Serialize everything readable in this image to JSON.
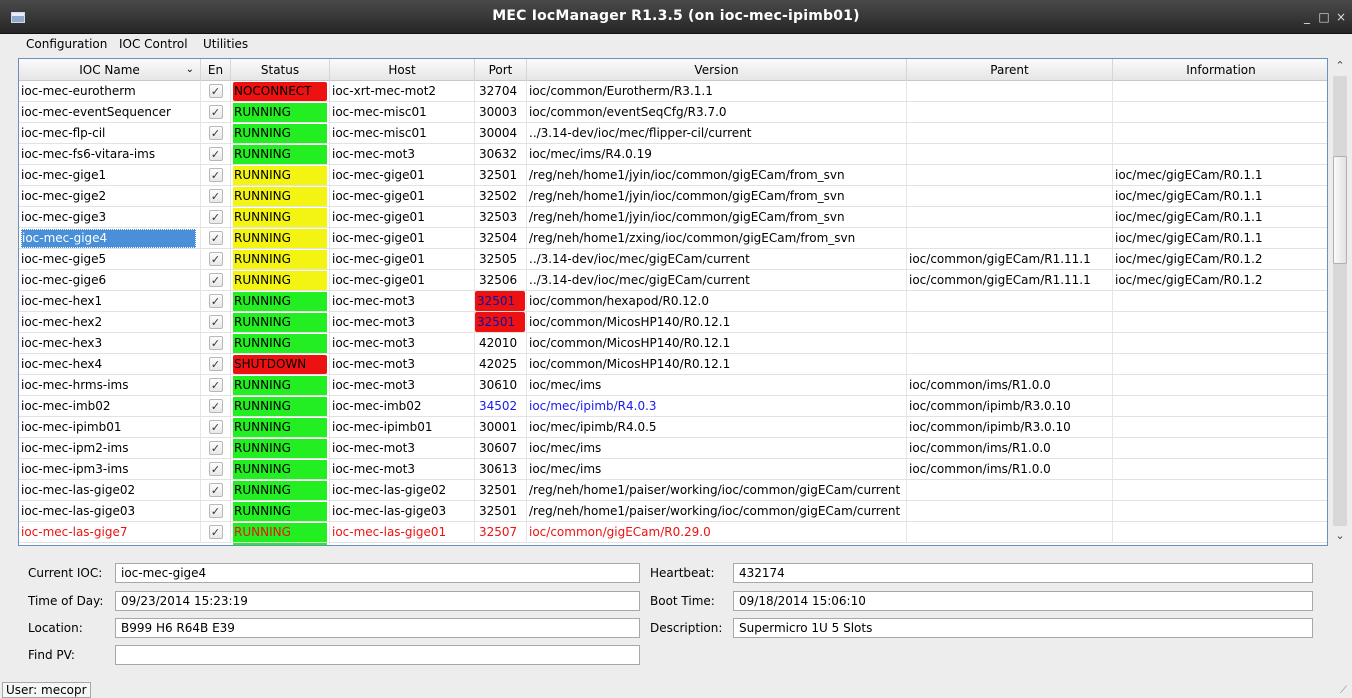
{
  "window": {
    "title": "MEC IocManager R1.3.5 (on ioc-mec-ipimb01)",
    "minimize_glyph": "_",
    "maximize_glyph": "□",
    "close_glyph": "×"
  },
  "menu": [
    "Configuration",
    "IOC Control",
    "Utilities"
  ],
  "table": {
    "headers": {
      "name": "IOC Name",
      "en": "En",
      "status": "Status",
      "host": "Host",
      "port": "Port",
      "version": "Version",
      "parent": "Parent",
      "info": "Information"
    },
    "sort_glyph": "⌄",
    "check_glyph": "✓",
    "rows": [
      {
        "name": "ioc-mec-eurotherm",
        "status": "NOCONNECT",
        "status_color": "red",
        "host": "ioc-xrt-mec-mot2",
        "port": "32704",
        "version": "ioc/common/Eurotherm/R3.1.1",
        "parent": "",
        "info": ""
      },
      {
        "name": "ioc-mec-eventSequencer",
        "status": "RUNNING",
        "status_color": "green",
        "host": "ioc-mec-misc01",
        "port": "30003",
        "version": "ioc/common/eventSeqCfg/R3.7.0",
        "parent": "",
        "info": ""
      },
      {
        "name": "ioc-mec-flp-cil",
        "status": "RUNNING",
        "status_color": "green",
        "host": "ioc-mec-misc01",
        "port": "30004",
        "version": "../3.14-dev/ioc/mec/flipper-cil/current",
        "parent": "",
        "info": ""
      },
      {
        "name": "ioc-mec-fs6-vitara-ims",
        "status": "RUNNING",
        "status_color": "green",
        "host": "ioc-mec-mot3",
        "port": "30632",
        "version": "ioc/mec/ims/R4.0.19",
        "parent": "",
        "info": ""
      },
      {
        "name": "ioc-mec-gige1",
        "status": "RUNNING",
        "status_color": "yellow",
        "host": "ioc-mec-gige01",
        "port": "32501",
        "version": "/reg/neh/home1/jyin/ioc/common/gigECam/from_svn",
        "parent": "",
        "info": "ioc/mec/gigECam/R0.1.1"
      },
      {
        "name": "ioc-mec-gige2",
        "status": "RUNNING",
        "status_color": "yellow",
        "host": "ioc-mec-gige01",
        "port": "32502",
        "version": "/reg/neh/home1/jyin/ioc/common/gigECam/from_svn",
        "parent": "",
        "info": "ioc/mec/gigECam/R0.1.1"
      },
      {
        "name": "ioc-mec-gige3",
        "status": "RUNNING",
        "status_color": "yellow",
        "host": "ioc-mec-gige01",
        "port": "32503",
        "version": "/reg/neh/home1/jyin/ioc/common/gigECam/from_svn",
        "parent": "",
        "info": "ioc/mec/gigECam/R0.1.1"
      },
      {
        "name": "ioc-mec-gige4",
        "status": "RUNNING",
        "status_color": "yellow",
        "host": "ioc-mec-gige01",
        "port": "32504",
        "version": "/reg/neh/home1/zxing/ioc/common/gigECam/from_svn",
        "parent": "",
        "info": "ioc/mec/gigECam/R0.1.1",
        "selected": true
      },
      {
        "name": "ioc-mec-gige5",
        "status": "RUNNING",
        "status_color": "yellow",
        "host": "ioc-mec-gige01",
        "port": "32505",
        "version": "../3.14-dev/ioc/mec/gigECam/current",
        "parent": "ioc/common/gigECam/R1.11.1",
        "info": "ioc/mec/gigECam/R0.1.2"
      },
      {
        "name": "ioc-mec-gige6",
        "status": "RUNNING",
        "status_color": "yellow",
        "host": "ioc-mec-gige01",
        "port": "32506",
        "version": "../3.14-dev/ioc/mec/gigECam/current",
        "parent": "ioc/common/gigECam/R1.11.1",
        "info": "ioc/mec/gigECam/R0.1.2"
      },
      {
        "name": "ioc-mec-hex1",
        "status": "RUNNING",
        "status_color": "green",
        "host": "ioc-mec-mot3",
        "port": "32501",
        "port_bad": true,
        "version": "ioc/common/hexapod/R0.12.0",
        "parent": "",
        "info": ""
      },
      {
        "name": "ioc-mec-hex2",
        "status": "RUNNING",
        "status_color": "green",
        "host": "ioc-mec-mot3",
        "port": "32501",
        "port_bad": true,
        "version": "ioc/common/MicosHP140/R0.12.1",
        "parent": "",
        "info": ""
      },
      {
        "name": "ioc-mec-hex3",
        "status": "RUNNING",
        "status_color": "green",
        "host": "ioc-mec-mot3",
        "port": "42010",
        "version": "ioc/common/MicosHP140/R0.12.1",
        "parent": "",
        "info": ""
      },
      {
        "name": "ioc-mec-hex4",
        "status": "SHUTDOWN",
        "status_color": "red",
        "host": "ioc-mec-mot3",
        "port": "42025",
        "version": "ioc/common/MicosHP140/R0.12.1",
        "parent": "",
        "info": ""
      },
      {
        "name": "ioc-mec-hrms-ims",
        "status": "RUNNING",
        "status_color": "green",
        "host": "ioc-mec-mot3",
        "port": "30610",
        "version": "ioc/mec/ims",
        "parent": "ioc/common/ims/R1.0.0",
        "info": ""
      },
      {
        "name": "ioc-mec-imb02",
        "status": "RUNNING",
        "status_color": "green",
        "host": "ioc-mec-imb02",
        "port": "34502",
        "version": "ioc/mec/ipimb/R4.0.3",
        "parent": "ioc/common/ipimb/R3.0.10",
        "info": "",
        "blue_cols": true
      },
      {
        "name": "ioc-mec-ipimb01",
        "status": "RUNNING",
        "status_color": "green",
        "host": "ioc-mec-ipimb01",
        "port": "30001",
        "version": "ioc/mec/ipimb/R4.0.5",
        "parent": "ioc/common/ipimb/R3.0.10",
        "info": ""
      },
      {
        "name": "ioc-mec-ipm2-ims",
        "status": "RUNNING",
        "status_color": "green",
        "host": "ioc-mec-mot3",
        "port": "30607",
        "version": "ioc/mec/ims",
        "parent": "ioc/common/ims/R1.0.0",
        "info": ""
      },
      {
        "name": "ioc-mec-ipm3-ims",
        "status": "RUNNING",
        "status_color": "green",
        "host": "ioc-mec-mot3",
        "port": "30613",
        "version": "ioc/mec/ims",
        "parent": "ioc/common/ims/R1.0.0",
        "info": ""
      },
      {
        "name": "ioc-mec-las-gige02",
        "status": "RUNNING",
        "status_color": "green",
        "host": "ioc-mec-las-gige02",
        "port": "32501",
        "version": "/reg/neh/home1/paiser/working/ioc/common/gigECam/current",
        "parent": "",
        "info": ""
      },
      {
        "name": "ioc-mec-las-gige03",
        "status": "RUNNING",
        "status_color": "green",
        "host": "ioc-mec-las-gige03",
        "port": "32501",
        "version": "/reg/neh/home1/paiser/working/ioc/common/gigECam/current",
        "parent": "",
        "info": ""
      },
      {
        "name": "ioc-mec-las-gige7",
        "status": "RUNNING",
        "status_color": "green",
        "host": "ioc-mec-las-gige01",
        "port": "32507",
        "version": "ioc/common/gigECam/R0.29.0",
        "parent": "",
        "info": "",
        "red_text": true
      }
    ]
  },
  "scrollbar": {
    "up_glyph": "⌃",
    "down_glyph": "⌄"
  },
  "details": {
    "current_ioc_label": "Current IOC:",
    "current_ioc_value": "ioc-mec-gige4",
    "time_of_day_label": "Time of Day:",
    "time_of_day_value": "09/23/2014 15:23:19",
    "location_label": "Location:",
    "location_value": "B999 H6 R64B E39",
    "find_pv_label": "Find PV:",
    "find_pv_value": "",
    "heartbeat_label": "Heartbeat:",
    "heartbeat_value": "432174",
    "boot_time_label": "Boot Time:",
    "boot_time_value": "09/18/2014 15:06:10",
    "description_label": "Description:",
    "description_value": "Supermicro 1U 5 Slots"
  },
  "status_bar": {
    "user": "User: mecopr",
    "grip_glyph": "⟋"
  },
  "colors": {
    "green": "#22ee22",
    "yellow": "#f4f412",
    "red": "#ee1111",
    "blue_text": "#1a1aee",
    "red_text": "#ee1111",
    "selection": "#4a90d9"
  }
}
